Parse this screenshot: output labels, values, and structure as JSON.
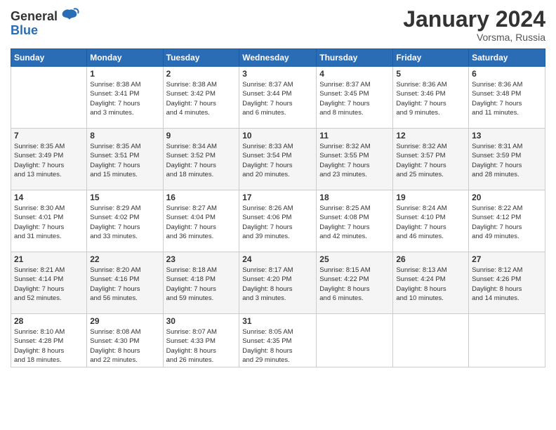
{
  "header": {
    "logo_general": "General",
    "logo_blue": "Blue",
    "month": "January 2024",
    "location": "Vorsma, Russia"
  },
  "days_of_week": [
    "Sunday",
    "Monday",
    "Tuesday",
    "Wednesday",
    "Thursday",
    "Friday",
    "Saturday"
  ],
  "weeks": [
    [
      {
        "day": "",
        "info": ""
      },
      {
        "day": "1",
        "info": "Sunrise: 8:38 AM\nSunset: 3:41 PM\nDaylight: 7 hours\nand 3 minutes."
      },
      {
        "day": "2",
        "info": "Sunrise: 8:38 AM\nSunset: 3:42 PM\nDaylight: 7 hours\nand 4 minutes."
      },
      {
        "day": "3",
        "info": "Sunrise: 8:37 AM\nSunset: 3:44 PM\nDaylight: 7 hours\nand 6 minutes."
      },
      {
        "day": "4",
        "info": "Sunrise: 8:37 AM\nSunset: 3:45 PM\nDaylight: 7 hours\nand 8 minutes."
      },
      {
        "day": "5",
        "info": "Sunrise: 8:36 AM\nSunset: 3:46 PM\nDaylight: 7 hours\nand 9 minutes."
      },
      {
        "day": "6",
        "info": "Sunrise: 8:36 AM\nSunset: 3:48 PM\nDaylight: 7 hours\nand 11 minutes."
      }
    ],
    [
      {
        "day": "7",
        "info": "Sunrise: 8:35 AM\nSunset: 3:49 PM\nDaylight: 7 hours\nand 13 minutes."
      },
      {
        "day": "8",
        "info": "Sunrise: 8:35 AM\nSunset: 3:51 PM\nDaylight: 7 hours\nand 15 minutes."
      },
      {
        "day": "9",
        "info": "Sunrise: 8:34 AM\nSunset: 3:52 PM\nDaylight: 7 hours\nand 18 minutes."
      },
      {
        "day": "10",
        "info": "Sunrise: 8:33 AM\nSunset: 3:54 PM\nDaylight: 7 hours\nand 20 minutes."
      },
      {
        "day": "11",
        "info": "Sunrise: 8:32 AM\nSunset: 3:55 PM\nDaylight: 7 hours\nand 23 minutes."
      },
      {
        "day": "12",
        "info": "Sunrise: 8:32 AM\nSunset: 3:57 PM\nDaylight: 7 hours\nand 25 minutes."
      },
      {
        "day": "13",
        "info": "Sunrise: 8:31 AM\nSunset: 3:59 PM\nDaylight: 7 hours\nand 28 minutes."
      }
    ],
    [
      {
        "day": "14",
        "info": "Sunrise: 8:30 AM\nSunset: 4:01 PM\nDaylight: 7 hours\nand 31 minutes."
      },
      {
        "day": "15",
        "info": "Sunrise: 8:29 AM\nSunset: 4:02 PM\nDaylight: 7 hours\nand 33 minutes."
      },
      {
        "day": "16",
        "info": "Sunrise: 8:27 AM\nSunset: 4:04 PM\nDaylight: 7 hours\nand 36 minutes."
      },
      {
        "day": "17",
        "info": "Sunrise: 8:26 AM\nSunset: 4:06 PM\nDaylight: 7 hours\nand 39 minutes."
      },
      {
        "day": "18",
        "info": "Sunrise: 8:25 AM\nSunset: 4:08 PM\nDaylight: 7 hours\nand 42 minutes."
      },
      {
        "day": "19",
        "info": "Sunrise: 8:24 AM\nSunset: 4:10 PM\nDaylight: 7 hours\nand 46 minutes."
      },
      {
        "day": "20",
        "info": "Sunrise: 8:22 AM\nSunset: 4:12 PM\nDaylight: 7 hours\nand 49 minutes."
      }
    ],
    [
      {
        "day": "21",
        "info": "Sunrise: 8:21 AM\nSunset: 4:14 PM\nDaylight: 7 hours\nand 52 minutes."
      },
      {
        "day": "22",
        "info": "Sunrise: 8:20 AM\nSunset: 4:16 PM\nDaylight: 7 hours\nand 56 minutes."
      },
      {
        "day": "23",
        "info": "Sunrise: 8:18 AM\nSunset: 4:18 PM\nDaylight: 7 hours\nand 59 minutes."
      },
      {
        "day": "24",
        "info": "Sunrise: 8:17 AM\nSunset: 4:20 PM\nDaylight: 8 hours\nand 3 minutes."
      },
      {
        "day": "25",
        "info": "Sunrise: 8:15 AM\nSunset: 4:22 PM\nDaylight: 8 hours\nand 6 minutes."
      },
      {
        "day": "26",
        "info": "Sunrise: 8:13 AM\nSunset: 4:24 PM\nDaylight: 8 hours\nand 10 minutes."
      },
      {
        "day": "27",
        "info": "Sunrise: 8:12 AM\nSunset: 4:26 PM\nDaylight: 8 hours\nand 14 minutes."
      }
    ],
    [
      {
        "day": "28",
        "info": "Sunrise: 8:10 AM\nSunset: 4:28 PM\nDaylight: 8 hours\nand 18 minutes."
      },
      {
        "day": "29",
        "info": "Sunrise: 8:08 AM\nSunset: 4:30 PM\nDaylight: 8 hours\nand 22 minutes."
      },
      {
        "day": "30",
        "info": "Sunrise: 8:07 AM\nSunset: 4:33 PM\nDaylight: 8 hours\nand 26 minutes."
      },
      {
        "day": "31",
        "info": "Sunrise: 8:05 AM\nSunset: 4:35 PM\nDaylight: 8 hours\nand 29 minutes."
      },
      {
        "day": "",
        "info": ""
      },
      {
        "day": "",
        "info": ""
      },
      {
        "day": "",
        "info": ""
      }
    ]
  ]
}
